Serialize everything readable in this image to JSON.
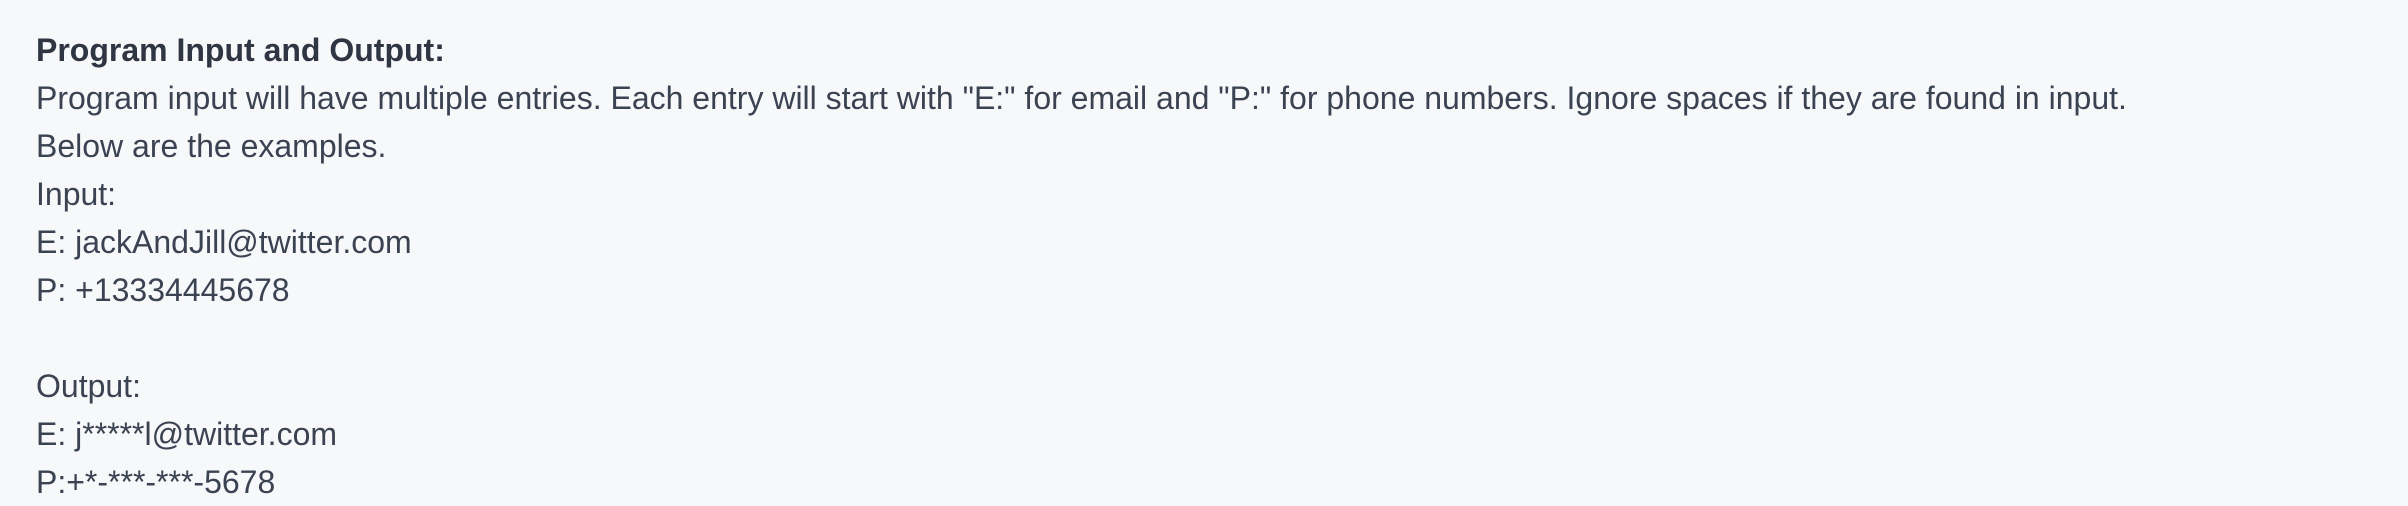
{
  "problem": {
    "heading": "Program Input and Output:",
    "description": "Program input will have multiple entries. Each entry will start with \"E:\" for email and \"P:\" for phone numbers. Ignore spaces if they are found in input.",
    "examples_intro": "Below are the examples.",
    "input_label": "Input:",
    "input_lines": [
      "E: jackAndJill@twitter.com",
      "P: +13334445678"
    ],
    "output_label": "Output:",
    "output_lines": [
      "E: j*****l@twitter.com",
      "P:+*-***-***-5678"
    ]
  }
}
